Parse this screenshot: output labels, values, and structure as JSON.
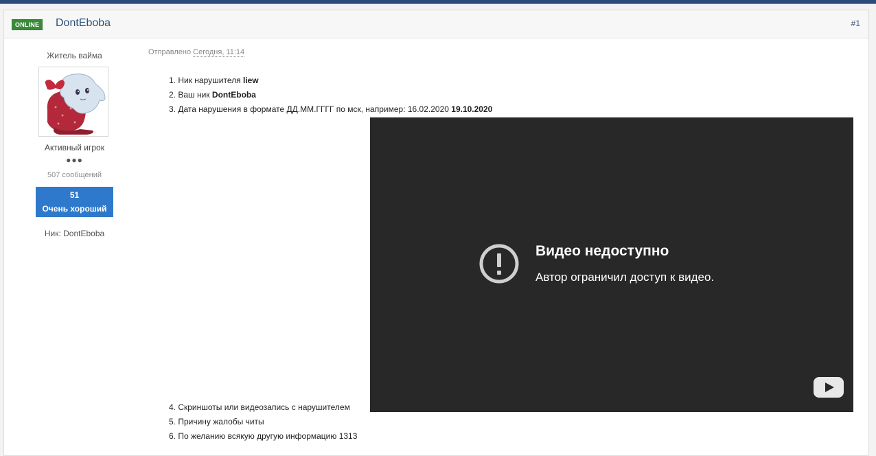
{
  "post": {
    "online_badge": "ONLINE",
    "author": "DontEboba",
    "post_number": "#1",
    "meta_prefix": "Отправлено",
    "meta_date": "Сегодня, 11:14"
  },
  "author_panel": {
    "user_title": "Житель вайма",
    "avatar_icon": "avatar-image",
    "rank": "Активный игрок",
    "rank_pips": "●●●",
    "post_count": "507 сообщений",
    "reputation_value": "51",
    "reputation_label": "Очень хороший",
    "nick_field": "Ник: DontEboba"
  },
  "body": {
    "item1_text": "1. Ник нарушителя ",
    "item1_value": "liew",
    "item2_text": "2. Ваш ник ",
    "item2_value": "DontEboba",
    "item3_text": "3. Дата нарушения в формате ДД.ММ.ГГГГ по мск, например: 16.02.2020 ",
    "item3_value": "19.10.2020",
    "item4_text": "4. Скриншоты или видеозапись с нарушителем",
    "item5_text": "5. Причину жалобы читы",
    "item6_text": "6. По желанию всякую другую информацию 1313"
  },
  "video": {
    "title": "Видео недоступно",
    "subtitle": "Автор ограничил доступ к видео.",
    "warning_icon": "exclamation-circle-icon",
    "logo_icon": "youtube-logo-icon"
  },
  "colors": {
    "topbar": "#2c4a7a",
    "online_badge": "#3a8a3a",
    "author_link": "#2b5178",
    "reputation": "#2e79cc",
    "video_bg": "#282828"
  }
}
